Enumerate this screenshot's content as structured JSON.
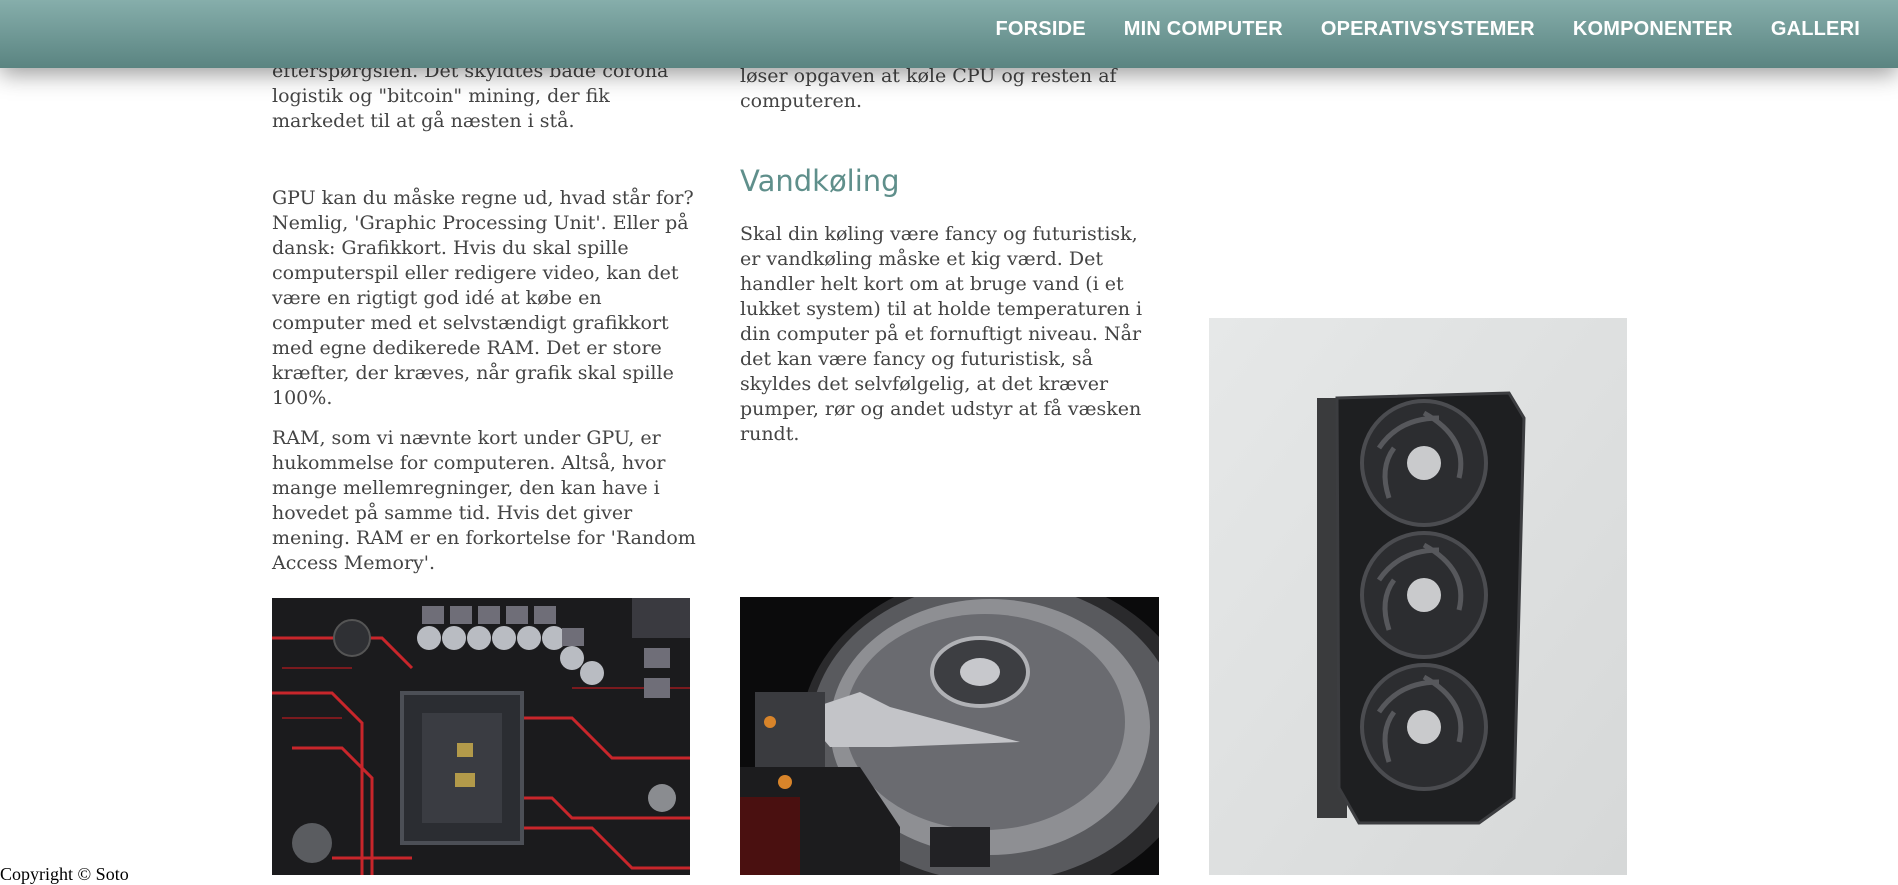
{
  "nav": {
    "items": [
      {
        "label": "FORSIDE"
      },
      {
        "label": "MIN COMPUTER"
      },
      {
        "label": "OPERATIVSYSTEMER"
      },
      {
        "label": "KOMPONENTER"
      },
      {
        "label": "GALLERI"
      }
    ]
  },
  "column1": {
    "top_text": "efterspørgslen. Det skyldtes både corona logistik og \"bitcoin\" mining, der fik markedet til at gå næsten i stå.",
    "gpu_text": "GPU kan du måske regne ud, hvad står for? Nemlig, 'Graphic Processing Unit'. Eller på dansk: Grafikkort. Hvis du skal spille computerspil eller redigere video, kan det være en rigtigt god idé at købe en computer med et selvstændigt grafikkort med egne dedikerede RAM. Det er store kræfter, der kræves, når grafik skal spille 100%.",
    "ram_text": "RAM, som vi nævnte kort under GPU, er hukommelse for computeren. Altså, hvor mange mellemregninger, den kan have i hovedet på samme tid. Hvis det giver mening. RAM er en forkortelse for 'Random Access Memory'."
  },
  "column2": {
    "top_text": "løser opgaven at køle CPU og resten af computeren.",
    "heading": "Vandkøling",
    "body": "Skal din køling være fancy og futuristisk, er vandkøling måske et kig værd. Det handler helt kort om at bruge vand (i et lukket system) til at holde temperaturen i din computer på et fornuftigt niveau. Når det kan være fancy og futuristisk, så skyldes det selvfølgelig, at det kræver pumper, rør og andet udstyr at få væsken rundt."
  },
  "footer": {
    "text": "Copyright © Soto"
  },
  "colors": {
    "navbar": "#76a09c",
    "heading": "#5f8f8b"
  }
}
